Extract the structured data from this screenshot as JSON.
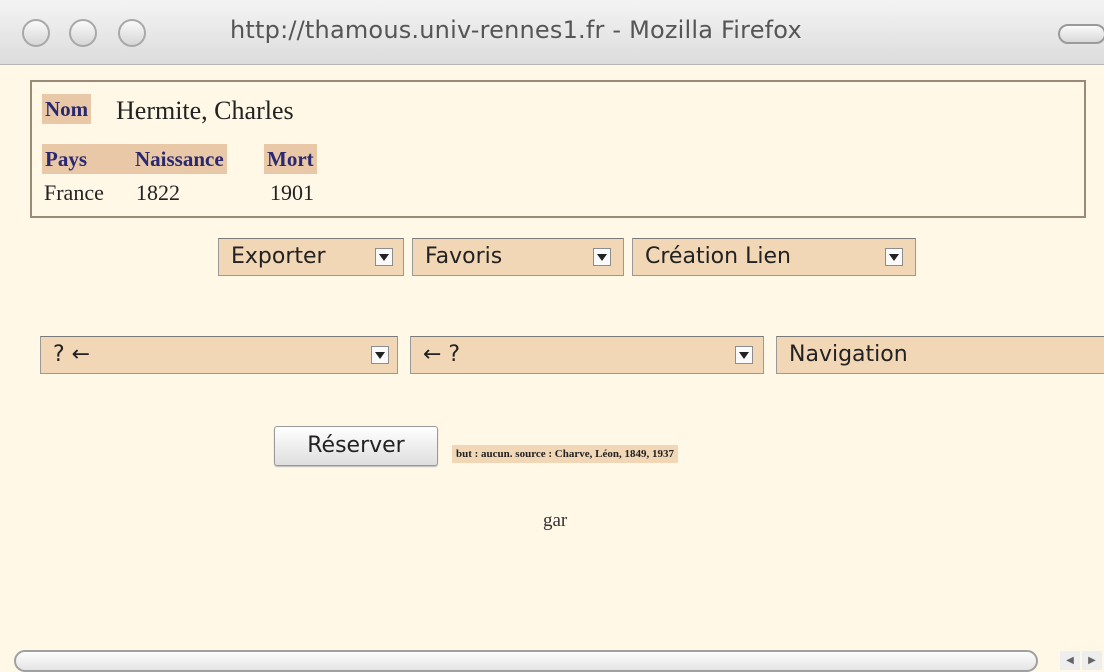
{
  "window": {
    "title": "http://thamous.univ-rennes1.fr - Mozilla Firefox"
  },
  "record": {
    "nom_label": "Nom",
    "nom_value": "Hermite, Charles",
    "pays_label": "Pays",
    "naissance_label": "Naissance",
    "mort_label": "Mort",
    "pays_value": "France",
    "naissance_value": "1822",
    "mort_value": "1901"
  },
  "toolbar": {
    "exporter": "Exporter",
    "favoris": "Favoris",
    "creation_lien": "Création Lien"
  },
  "nav": {
    "left_select": "? ←",
    "right_select": "← ?",
    "navigation": "Navigation"
  },
  "actions": {
    "reserver": "Réserver",
    "note": "but : aucun. source : Charve, Léon, 1849, 1937"
  },
  "footer_text": "gar",
  "icons": {
    "window_buttons": [
      "close-icon",
      "minimize-icon",
      "zoom-icon"
    ],
    "toolbar_toggle": "toolbar-toggle-icon",
    "scroll_left": "arrow-left-icon",
    "scroll_right": "arrow-right-icon"
  }
}
